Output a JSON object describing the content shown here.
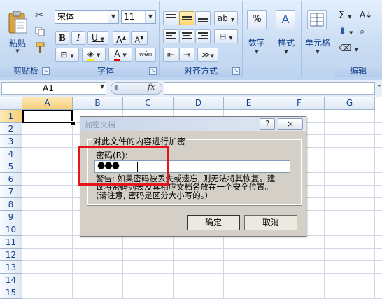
{
  "ribbon": {
    "clipboard": {
      "paste_label": "粘贴",
      "group_label": "剪贴板"
    },
    "font": {
      "font_name": "宋体",
      "font_size": "11",
      "group_label": "字体"
    },
    "alignment": {
      "group_label": "对齐方式"
    },
    "number": {
      "label": "数字",
      "icon_text": "%"
    },
    "styles": {
      "label": "样式"
    },
    "cells": {
      "label": "单元格"
    },
    "editing": {
      "group_label": "编辑"
    }
  },
  "formula_bar": {
    "name_box": "A1",
    "fx": "fx",
    "formula": ""
  },
  "grid": {
    "columns": [
      "A",
      "B",
      "C",
      "D",
      "E",
      "F",
      "G"
    ],
    "rows": [
      "1",
      "2",
      "3",
      "4",
      "5",
      "6",
      "7",
      "8",
      "9",
      "10",
      "11",
      "12",
      "13",
      "14",
      "15"
    ]
  },
  "dialog": {
    "title": "加密文档",
    "help_label": "?",
    "close_label": "×",
    "section_label": "对此文件的内容进行加密",
    "password_label": "密码(R):",
    "password_value": "●●●",
    "warning_line1": "警告: 如果密码被丢失或遗忘, 则无法将其恢复。建",
    "warning_line2": "议将密码列表及其相应文档名放在一个安全位置。",
    "warning_line3": "(请注意, 密码是区分大小写的。)",
    "ok_label": "确定",
    "cancel_label": "取消"
  },
  "colors": {
    "highlight_box": "#e8141b",
    "ribbon_text": "#15428b"
  }
}
